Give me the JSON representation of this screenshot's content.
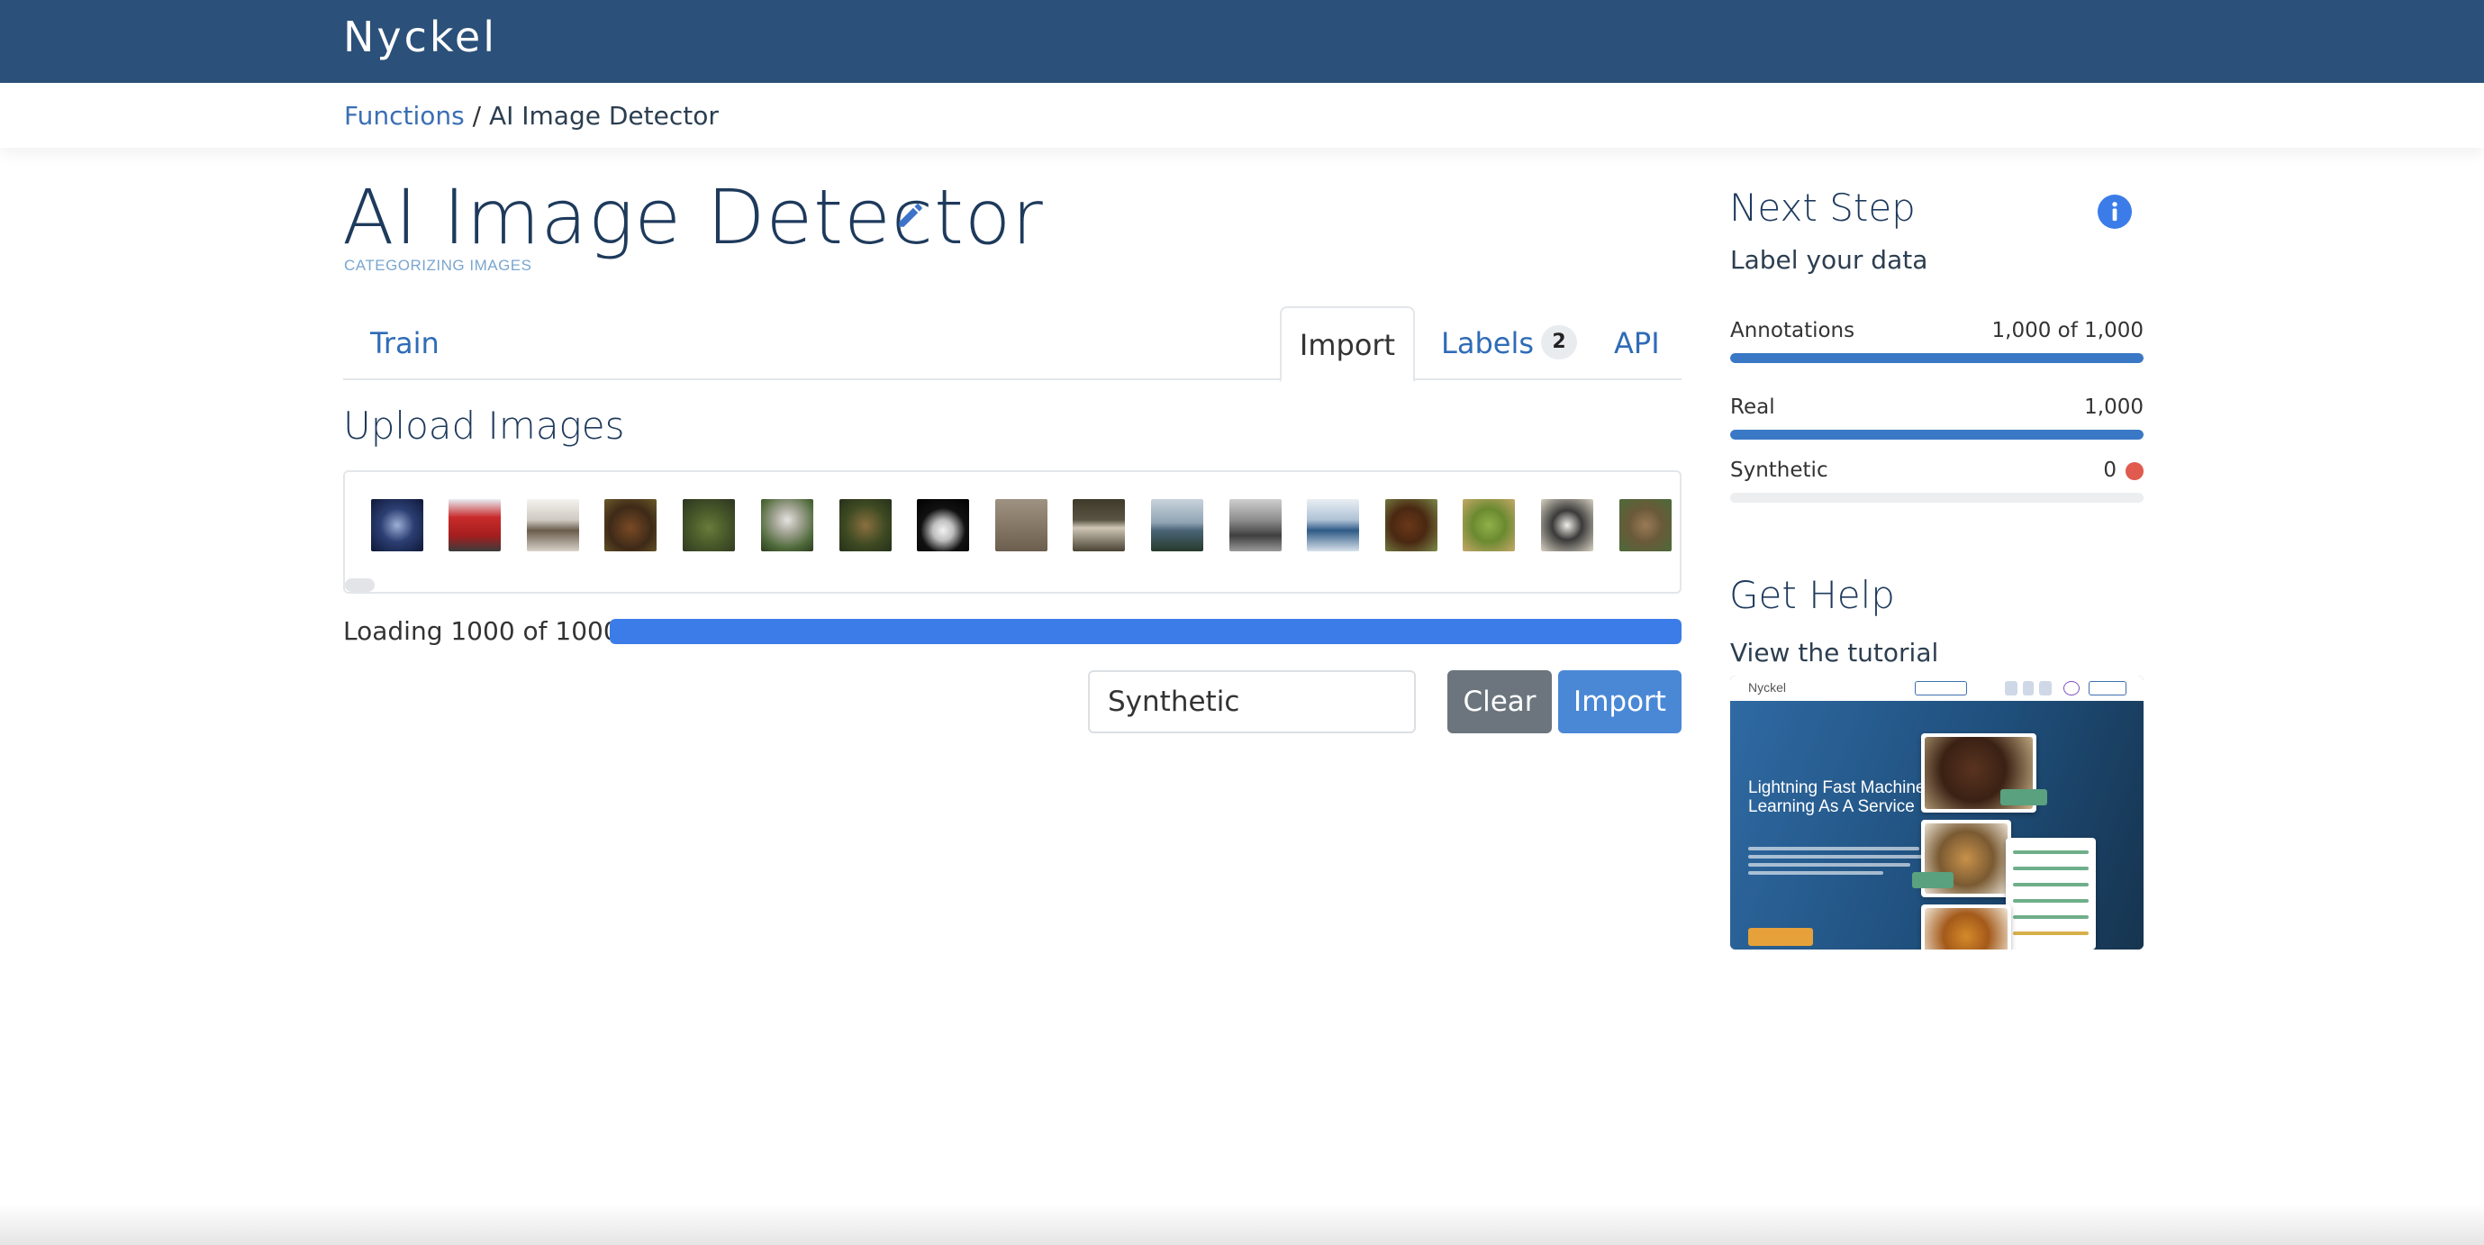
{
  "header": {
    "brand": "Nyckel"
  },
  "breadcrumb": {
    "parent": "Functions",
    "separator": "/",
    "current": "AI Image Detector"
  },
  "function": {
    "title": "AI Image Detector",
    "subtitle": "CATEGORIZING IMAGES"
  },
  "tabs": [
    {
      "label": "Train"
    },
    {
      "label": "Import",
      "active": true
    },
    {
      "label": "Labels",
      "badge": "2"
    },
    {
      "label": "API"
    }
  ],
  "upload": {
    "title": "Upload Images",
    "loading_text": "Loading 1000 of 1000",
    "progress_fraction": 1.0,
    "label_input_value": "Synthetic",
    "clear_label": "Clear",
    "import_label": "Import"
  },
  "next_step": {
    "title": "Next Step",
    "subtitle": "Label your data",
    "metrics": [
      {
        "name": "Annotations",
        "value": "1,000 of 1,000",
        "fraction": 1.0
      },
      {
        "name": "Real",
        "value": "1,000",
        "fraction": 1.0
      },
      {
        "name": "Synthetic",
        "value": "0",
        "fraction": 0.0,
        "status": "error"
      }
    ]
  },
  "help": {
    "title": "Get Help",
    "subtitle": "View the tutorial",
    "tutorial_brand": "Nyckel",
    "tutorial_headline": "Lightning Fast Machine Learning As A Service"
  },
  "icons": {
    "edit": "pencil-icon",
    "info": "info-icon"
  },
  "colors": {
    "header": "#2b5079",
    "accent": "#3b7ce8",
    "link": "#2f6cb7",
    "error": "#e05a4e"
  }
}
